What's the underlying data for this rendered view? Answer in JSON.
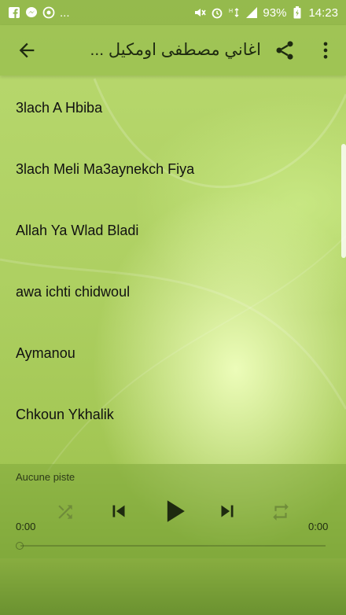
{
  "status_bar": {
    "battery_percent": "93%",
    "time": "14:23",
    "notification_dots": "...",
    "left_icons": [
      "facebook-icon",
      "messenger-icon",
      "circle-app-icon"
    ],
    "right_icons": [
      "mute-icon",
      "alarm-icon",
      "data-icon",
      "signal-icon",
      "battery-icon"
    ]
  },
  "app_bar": {
    "title": "اغاني مصطفى اومكيل ...",
    "back_icon": "arrow-back-icon",
    "share_icon": "share-icon",
    "more_icon": "more-vert-icon"
  },
  "songs": [
    "3lach A Hbiba",
    "3lach Meli Ma3aynekch Fiya",
    "Allah Ya Wlad Bladi",
    "awa ichti chidwoul",
    "Aymanou",
    "Chkoun Ykhalik"
  ],
  "player": {
    "track_label": "Aucune piste",
    "time_elapsed": "0:00",
    "time_total": "0:00",
    "progress_fraction": 0,
    "controls": [
      "shuffle-icon",
      "skip-previous-icon",
      "play-icon",
      "skip-next-icon",
      "repeat-icon"
    ]
  },
  "colors": {
    "accent": "#a8cc5c",
    "text": "#111111",
    "icon_dim": "#6f8c3a",
    "icon_strong": "#1e2a10"
  }
}
